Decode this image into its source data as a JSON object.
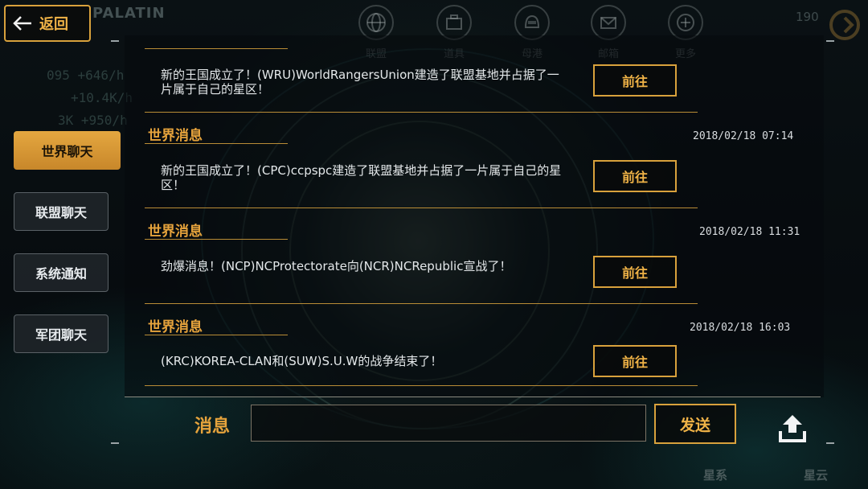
{
  "top": {
    "title": "PALATIN",
    "number": "190",
    "nav": [
      {
        "label": "联盟",
        "icon": "globe-icon"
      },
      {
        "label": "道具",
        "icon": "toolbox-icon"
      },
      {
        "label": "母港",
        "icon": "helmet-icon"
      },
      {
        "label": "邮箱",
        "icon": "mail-icon"
      },
      {
        "label": "更多",
        "icon": "plus-icon"
      }
    ],
    "resources": [
      "095 +646/h",
      "+10.4K/h",
      "3K +950/h"
    ]
  },
  "back": {
    "label": "返回",
    "icon": "back-arrow-icon"
  },
  "tabs": [
    {
      "label": "世界聊天",
      "active": true
    },
    {
      "label": "联盟聊天",
      "active": false
    },
    {
      "label": "系统通知",
      "active": false
    },
    {
      "label": "军团聊天",
      "active": false
    }
  ],
  "messages": [
    {
      "head": "",
      "time": "",
      "text": "新的王国成立了！(WRU)WorldRangersUnion建造了联盟基地并占据了一片属于自己的星区！",
      "button": "前往"
    },
    {
      "head": "世界消息",
      "time": "2018/02/18 07:14",
      "text": "新的王国成立了！(CPC)ccpspc建造了联盟基地并占据了一片属于自己的星区！",
      "button": "前往"
    },
    {
      "head": "世界消息",
      "time": "2018/02/18 11:31",
      "text": "劲爆消息！(NCP)NCProtectorate向(NCR)NCRepublic宣战了！",
      "button": "前往"
    },
    {
      "head": "世界消息",
      "time": "2018/02/18 16:03",
      "text": "(KRC)KOREA-CLAN和(SUW)S.U.W的战争结束了！",
      "button": "前往"
    }
  ],
  "composer": {
    "label": "消息",
    "input_value": "",
    "input_placeholder": "",
    "send_label": "发送",
    "upload_icon": "upload-icon"
  },
  "bottom": {
    "left_label": "星系",
    "right_label": "星云"
  },
  "colors": {
    "accent": "#d8a13c",
    "accent_text": "#f0b347",
    "active_tab": "#e4a740",
    "divider": "#b98c36"
  }
}
